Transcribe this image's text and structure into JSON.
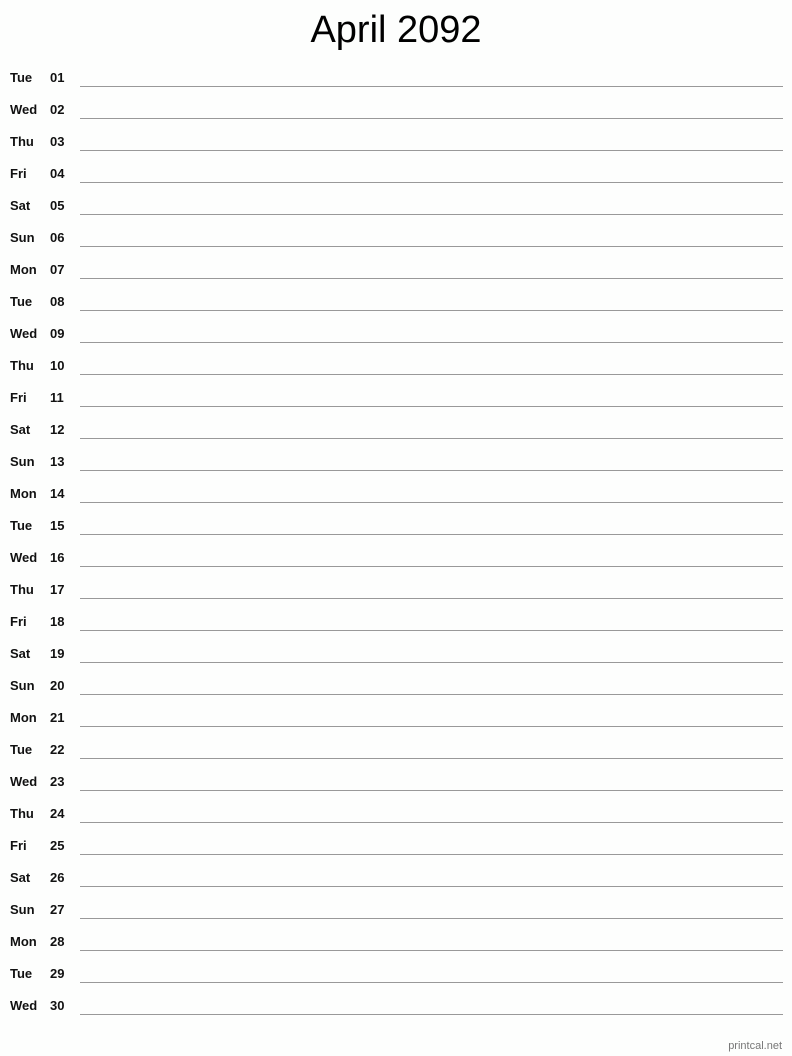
{
  "title": "April 2092",
  "days": [
    {
      "dow": "Tue",
      "num": "01"
    },
    {
      "dow": "Wed",
      "num": "02"
    },
    {
      "dow": "Thu",
      "num": "03"
    },
    {
      "dow": "Fri",
      "num": "04"
    },
    {
      "dow": "Sat",
      "num": "05"
    },
    {
      "dow": "Sun",
      "num": "06"
    },
    {
      "dow": "Mon",
      "num": "07"
    },
    {
      "dow": "Tue",
      "num": "08"
    },
    {
      "dow": "Wed",
      "num": "09"
    },
    {
      "dow": "Thu",
      "num": "10"
    },
    {
      "dow": "Fri",
      "num": "11"
    },
    {
      "dow": "Sat",
      "num": "12"
    },
    {
      "dow": "Sun",
      "num": "13"
    },
    {
      "dow": "Mon",
      "num": "14"
    },
    {
      "dow": "Tue",
      "num": "15"
    },
    {
      "dow": "Wed",
      "num": "16"
    },
    {
      "dow": "Thu",
      "num": "17"
    },
    {
      "dow": "Fri",
      "num": "18"
    },
    {
      "dow": "Sat",
      "num": "19"
    },
    {
      "dow": "Sun",
      "num": "20"
    },
    {
      "dow": "Mon",
      "num": "21"
    },
    {
      "dow": "Tue",
      "num": "22"
    },
    {
      "dow": "Wed",
      "num": "23"
    },
    {
      "dow": "Thu",
      "num": "24"
    },
    {
      "dow": "Fri",
      "num": "25"
    },
    {
      "dow": "Sat",
      "num": "26"
    },
    {
      "dow": "Sun",
      "num": "27"
    },
    {
      "dow": "Mon",
      "num": "28"
    },
    {
      "dow": "Tue",
      "num": "29"
    },
    {
      "dow": "Wed",
      "num": "30"
    }
  ],
  "footer": "printcal.net"
}
